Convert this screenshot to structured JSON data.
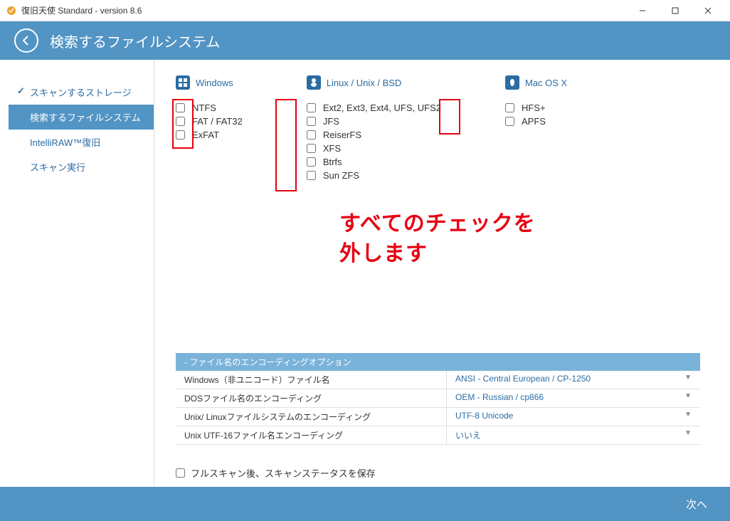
{
  "window": {
    "title": "復旧天使 Standard - version 8.6"
  },
  "header": {
    "title": "検索するファイルシステム"
  },
  "sidebar": {
    "items": [
      {
        "label": "スキャンするストレージ",
        "completed": true
      },
      {
        "label": "検索するファイルシステム",
        "active": true
      },
      {
        "label": "IntelliRAW™復旧"
      },
      {
        "label": "スキャン実行"
      }
    ]
  },
  "filesystems": {
    "windows": {
      "title": "Windows",
      "items": [
        "NTFS",
        "FAT / FAT32",
        "ExFAT"
      ]
    },
    "linux": {
      "title": "Linux / Unix / BSD",
      "items": [
        "Ext2, Ext3, Ext4, UFS, UFS2",
        "JFS",
        "ReiserFS",
        "XFS",
        "Btrfs",
        "Sun ZFS"
      ]
    },
    "mac": {
      "title": "Mac OS X",
      "items": [
        "HFS+",
        "APFS"
      ]
    }
  },
  "annotation": {
    "line1": "すべてのチェックを",
    "line2": "外します"
  },
  "encoding": {
    "header": "-   ファイル名のエンコーディングオプション",
    "rows": [
      {
        "label": "Windows（非ユニコード）ファイル名",
        "value": "ANSI - Central European / CP-1250"
      },
      {
        "label": "DOSファイル名のエンコーディング",
        "value": "OEM - Russian / cp866"
      },
      {
        "label": "Unix/ Linuxファイルシステムのエンコーディング",
        "value": "UTF-8 Unicode"
      },
      {
        "label": "Unix UTF-16ファイル名エンコーディング",
        "value": "いいえ"
      }
    ]
  },
  "fullscan": {
    "label": "フルスキャン後、スキャンステータスを保存"
  },
  "footer": {
    "next": "次へ"
  }
}
